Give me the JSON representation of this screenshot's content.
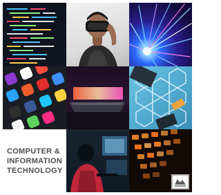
{
  "panel": {
    "title_lines": [
      "COMPUTER &",
      "INFORMATION",
      "TECHNOLOGY"
    ]
  },
  "tiles": [
    {
      "icon": "code-screen"
    },
    {
      "icon": "vr-headset-person"
    },
    {
      "icon": "fiber-optic-lights"
    },
    {
      "icon": "smartphone-app-icons"
    },
    {
      "icon": "laptop-glow"
    },
    {
      "icon": "hexagon-circuit"
    },
    {
      "icon": "person-at-computer"
    },
    {
      "icon": "lit-keyboard"
    }
  ],
  "colors": {
    "title_text": "#4d4d4d",
    "background": "#ffffff"
  }
}
